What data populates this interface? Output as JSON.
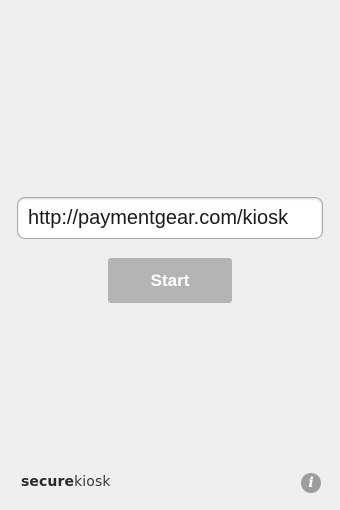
{
  "url_field": {
    "value": "http://paymentgear.com/kiosk"
  },
  "start_button": {
    "label": "Start"
  },
  "brand": {
    "strong": "secure",
    "light": "kiosk"
  },
  "info_button": {
    "icon": "info-icon",
    "glyph": "i"
  },
  "colors": {
    "background": "#efefef",
    "button": "#b4b4b4",
    "info_icon": "#9e9e9e"
  }
}
